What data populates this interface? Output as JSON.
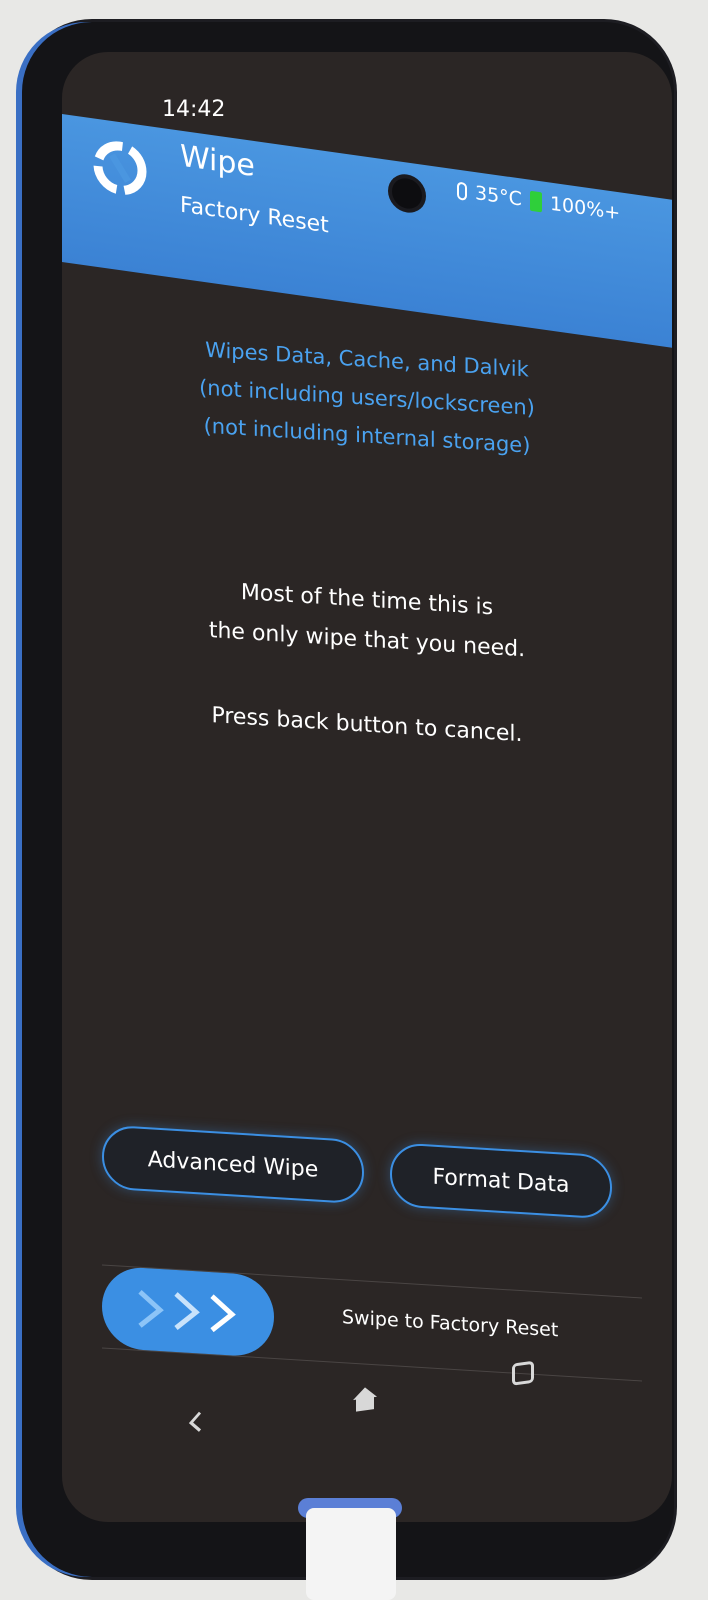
{
  "status_bar": {
    "time": "14:42",
    "temperature": "35°C",
    "battery": "100%+",
    "battery_color": "#2fcf3a"
  },
  "header": {
    "title": "Wipe",
    "subtitle": "Factory Reset",
    "icon": "twrp-logo-icon",
    "background_color": "#4a96e0"
  },
  "info_blue": {
    "line1": "Wipes Data, Cache, and Dalvik",
    "line2": "(not including users/lockscreen)",
    "line3": "(not including internal storage)",
    "color": "#4aa2f0"
  },
  "info_white": {
    "line1": "Most of the time this is",
    "line2": "the only wipe that you need."
  },
  "cancel_hint": "Press back button to cancel.",
  "buttons": {
    "advanced_wipe": "Advanced Wipe",
    "format_data": "Format Data"
  },
  "swipe": {
    "label": "Swipe to Factory Reset",
    "handle_icon": "triple-chevron-right-icon",
    "accent_color": "#3b8fe3"
  },
  "nav": {
    "back_icon": "back-chevron-icon",
    "home_icon": "home-icon",
    "recents_icon": "recents-square-icon"
  }
}
